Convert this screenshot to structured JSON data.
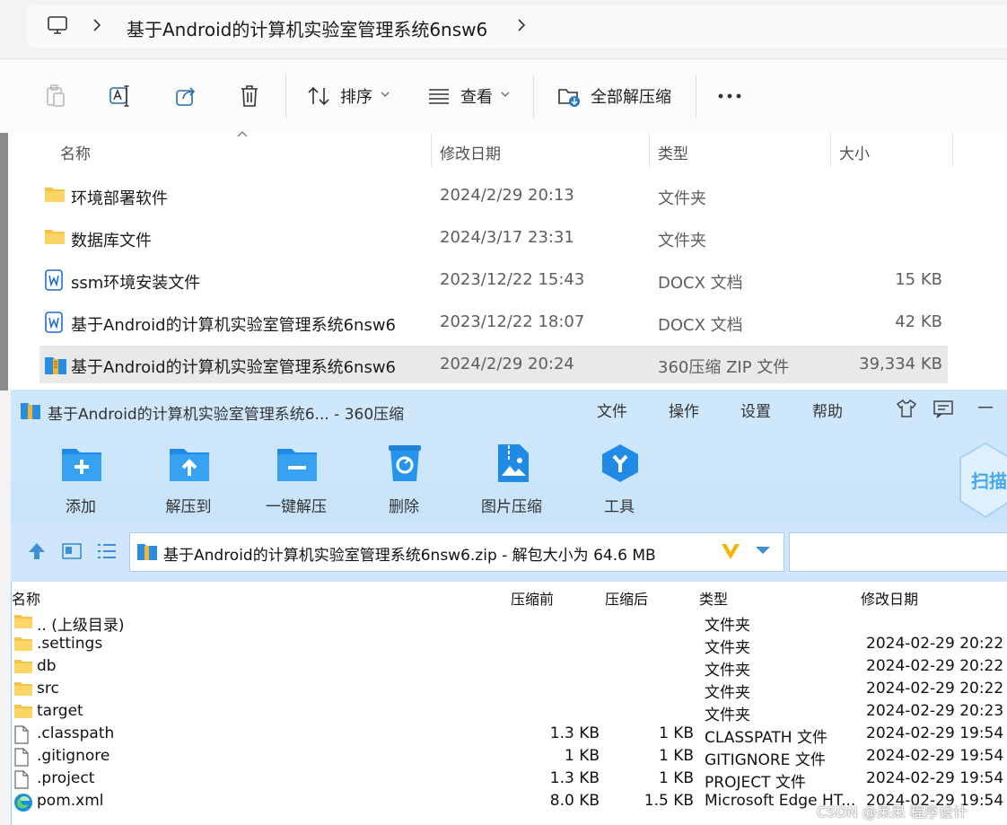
{
  "address_bar": {
    "breadcrumb": "基于Android的计算机实验室管理系统6nsw6"
  },
  "toolbar": {
    "sort_label": "排序",
    "view_label": "查看",
    "extract_all_label": "全部解压缩"
  },
  "explorer": {
    "columns": [
      "名称",
      "修改日期",
      "类型",
      "大小"
    ],
    "rows": [
      {
        "name": "环境部署软件",
        "date": "2024/2/29 20:13",
        "type": "文件夹",
        "size": "",
        "icon": "folder-icon"
      },
      {
        "name": "数据库文件",
        "date": "2024/3/17 23:31",
        "type": "文件夹",
        "size": "",
        "icon": "folder-icon"
      },
      {
        "name": "ssm环境安装文件",
        "date": "2023/12/22 15:43",
        "type": "DOCX 文档",
        "size": "15 KB",
        "icon": "word-doc-icon"
      },
      {
        "name": "基于Android的计算机实验室管理系统6nsw6",
        "date": "2023/12/22 18:07",
        "type": "DOCX 文档",
        "size": "42 KB",
        "icon": "word-doc-icon"
      },
      {
        "name": "基于Android的计算机实验室管理系统6nsw6",
        "date": "2024/2/29 20:24",
        "type": "360压缩 ZIP 文件",
        "size": "39,334 KB",
        "icon": "zip-icon"
      }
    ]
  },
  "zip_window": {
    "title": "基于Android的计算机实验室管理系统6... - 360压缩",
    "menu": [
      "文件",
      "操作",
      "设置",
      "帮助"
    ],
    "scan_label": "扫描",
    "ribbon": [
      "添加",
      "解压到",
      "一键解压",
      "删除",
      "图片压缩",
      "工具"
    ],
    "path_text": "基于Android的计算机实验室管理系统6nsw6.zip - 解包大小为 64.6 MB",
    "columns": [
      "名称",
      "压缩前",
      "压缩后",
      "类型",
      "修改日期"
    ],
    "rows": [
      {
        "name": ".. (上级目录)",
        "before": "",
        "after": "",
        "type": "文件夹",
        "date": "",
        "icon": "folder-icon"
      },
      {
        "name": ".settings",
        "before": "",
        "after": "",
        "type": "文件夹",
        "date": "2024-02-29 20:22",
        "icon": "folder-icon"
      },
      {
        "name": "db",
        "before": "",
        "after": "",
        "type": "文件夹",
        "date": "2024-02-29 20:22",
        "icon": "folder-icon"
      },
      {
        "name": "src",
        "before": "",
        "after": "",
        "type": "文件夹",
        "date": "2024-02-29 20:22",
        "icon": "folder-icon"
      },
      {
        "name": "target",
        "before": "",
        "after": "",
        "type": "文件夹",
        "date": "2024-02-29 20:23",
        "icon": "folder-icon"
      },
      {
        "name": ".classpath",
        "before": "1.3 KB",
        "after": "1 KB",
        "type": "CLASSPATH 文件",
        "date": "2024-02-29 19:54",
        "icon": "file-icon"
      },
      {
        "name": ".gitignore",
        "before": "1 KB",
        "after": "1 KB",
        "type": "GITIGNORE 文件",
        "date": "2024-02-29 19:54",
        "icon": "file-icon"
      },
      {
        "name": ".project",
        "before": "1.3 KB",
        "after": "1 KB",
        "type": "PROJECT 文件",
        "date": "2024-02-29 19:54",
        "icon": "file-icon"
      },
      {
        "name": "pom.xml",
        "before": "8.0 KB",
        "after": "1.5 KB",
        "type": "Microsoft Edge HT...",
        "date": "2024-02-29 19:54",
        "icon": "edge-icon"
      }
    ]
  },
  "watermark": "CSDN @呆呆 程序设计",
  "colors": {
    "folder": "#f6c343",
    "zip_blue": "#2a8de0",
    "selected_row": "#e9e9e9",
    "zip_bg": "#cfe7fb"
  }
}
